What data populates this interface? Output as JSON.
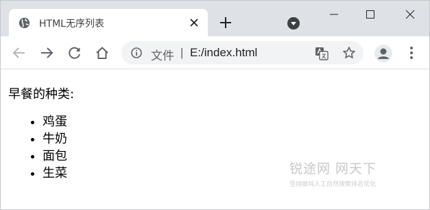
{
  "tab": {
    "title": "HTML无序列表",
    "favicon_icon": "globe-icon",
    "close_icon": "close-icon"
  },
  "titlebar": {
    "new_tab_icon": "plus-icon",
    "profile_dropdown_icon": "chevron-down-circle-icon",
    "minimize_icon": "minimize-icon",
    "maximize_icon": "maximize-icon",
    "close_window_icon": "close-icon"
  },
  "toolbar": {
    "back_icon": "arrow-left-icon",
    "forward_icon": "arrow-right-icon",
    "reload_icon": "reload-icon",
    "home_icon": "home-icon",
    "omnibox": {
      "info_icon": "info-icon",
      "scheme_label": "文件",
      "divider": "|",
      "url": "E:/index.html",
      "translate_icon": "translate-icon",
      "bookmark_icon": "star-icon"
    },
    "avatar_icon": "person-icon",
    "menu_icon": "more-vert-icon"
  },
  "page": {
    "heading": "早餐的种类:",
    "items": [
      "鸡蛋",
      "牛奶",
      "面包",
      "生菜"
    ]
  },
  "watermark": {
    "main": "锐途网  网天下",
    "sub": "坚持做纯人工自然搜索排名优化"
  },
  "colors": {
    "tabstrip_bg": "#dee1e6",
    "omnibox_bg": "#f1f3f4",
    "icon_gray": "#5f6368",
    "watermark_gray": "#c7c7c7"
  }
}
